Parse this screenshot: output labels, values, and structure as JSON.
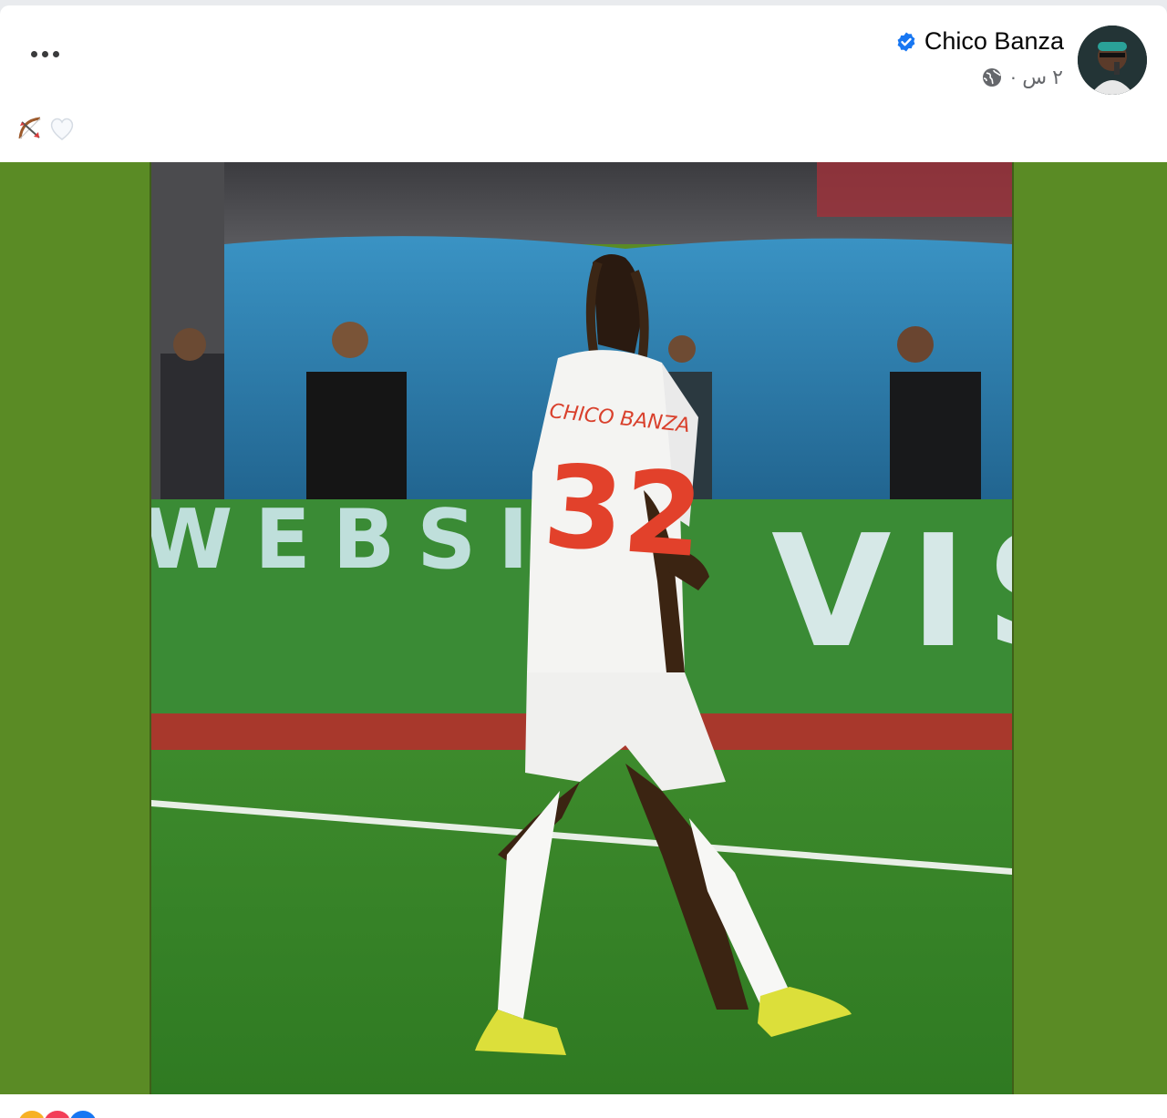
{
  "post": {
    "author": "Chico Banza",
    "timestamp": "٢ س ·",
    "verified": true,
    "caption_icons": [
      "bow-arrow-emoji",
      "white-heart-emoji"
    ],
    "photo_text": {
      "jersey_name": "CHICO BANZA",
      "jersey_number": "32",
      "board_left": "WEBSIT",
      "board_right": "VIS"
    },
    "colors": {
      "accent_verified": "#1877f2",
      "media_background": "#5a8b25",
      "jersey_number": "#e2412b"
    }
  }
}
